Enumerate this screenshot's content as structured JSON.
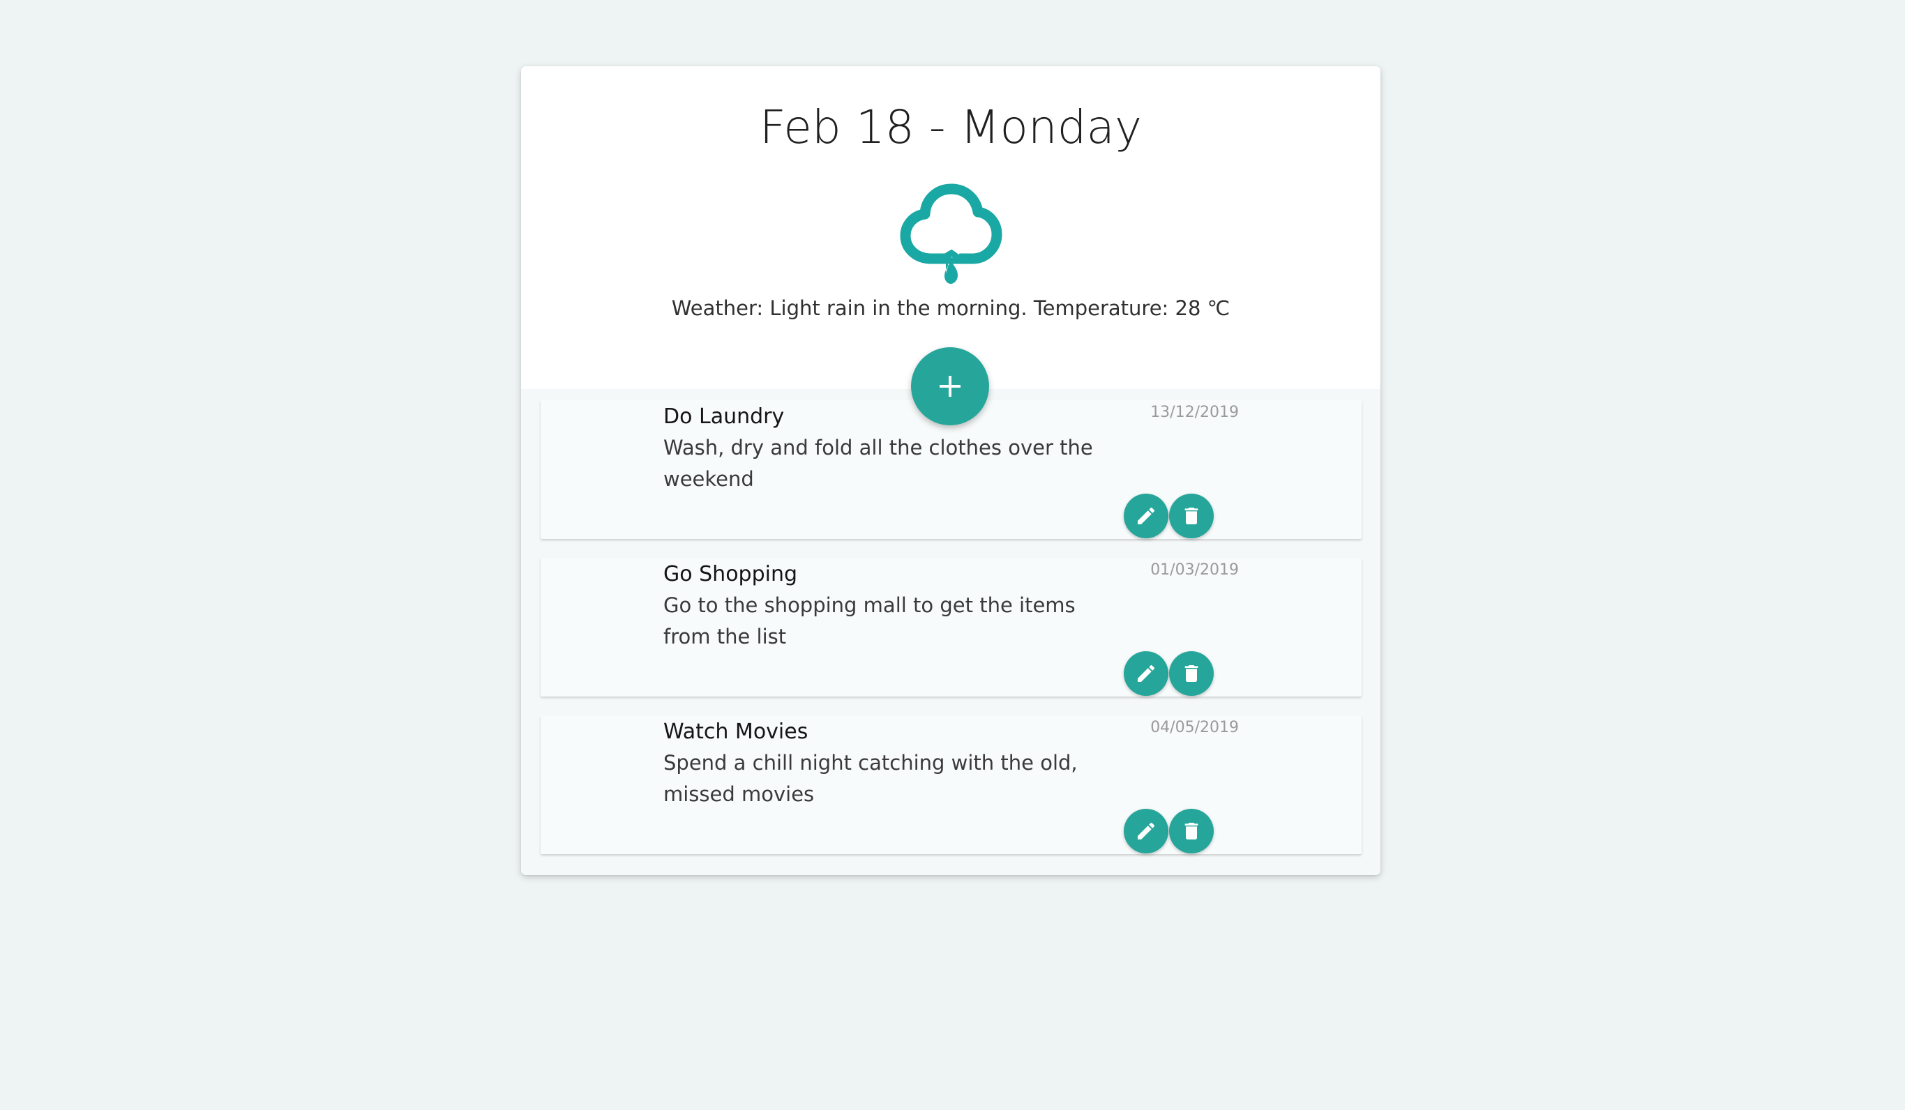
{
  "header": {
    "title": "Feb 18 - Monday",
    "weather_icon": "rain-cloud-icon",
    "weather_text": "Weather: Light rain in the morning. Temperature: 28 ℃"
  },
  "add_button": {
    "icon": "plus-icon"
  },
  "todos": [
    {
      "title": "Do Laundry",
      "description": "Wash, dry and fold all the clothes over the weekend",
      "date": "13/12/2019"
    },
    {
      "title": "Go Shopping",
      "description": "Go to the shopping mall to get the items from the list",
      "date": "01/03/2019"
    },
    {
      "title": "Watch Movies",
      "description": "Spend a chill night catching with the old, missed movies",
      "date": "04/05/2019"
    }
  ],
  "colors": {
    "accent": "#26a69a",
    "background": "#eef3f3"
  }
}
